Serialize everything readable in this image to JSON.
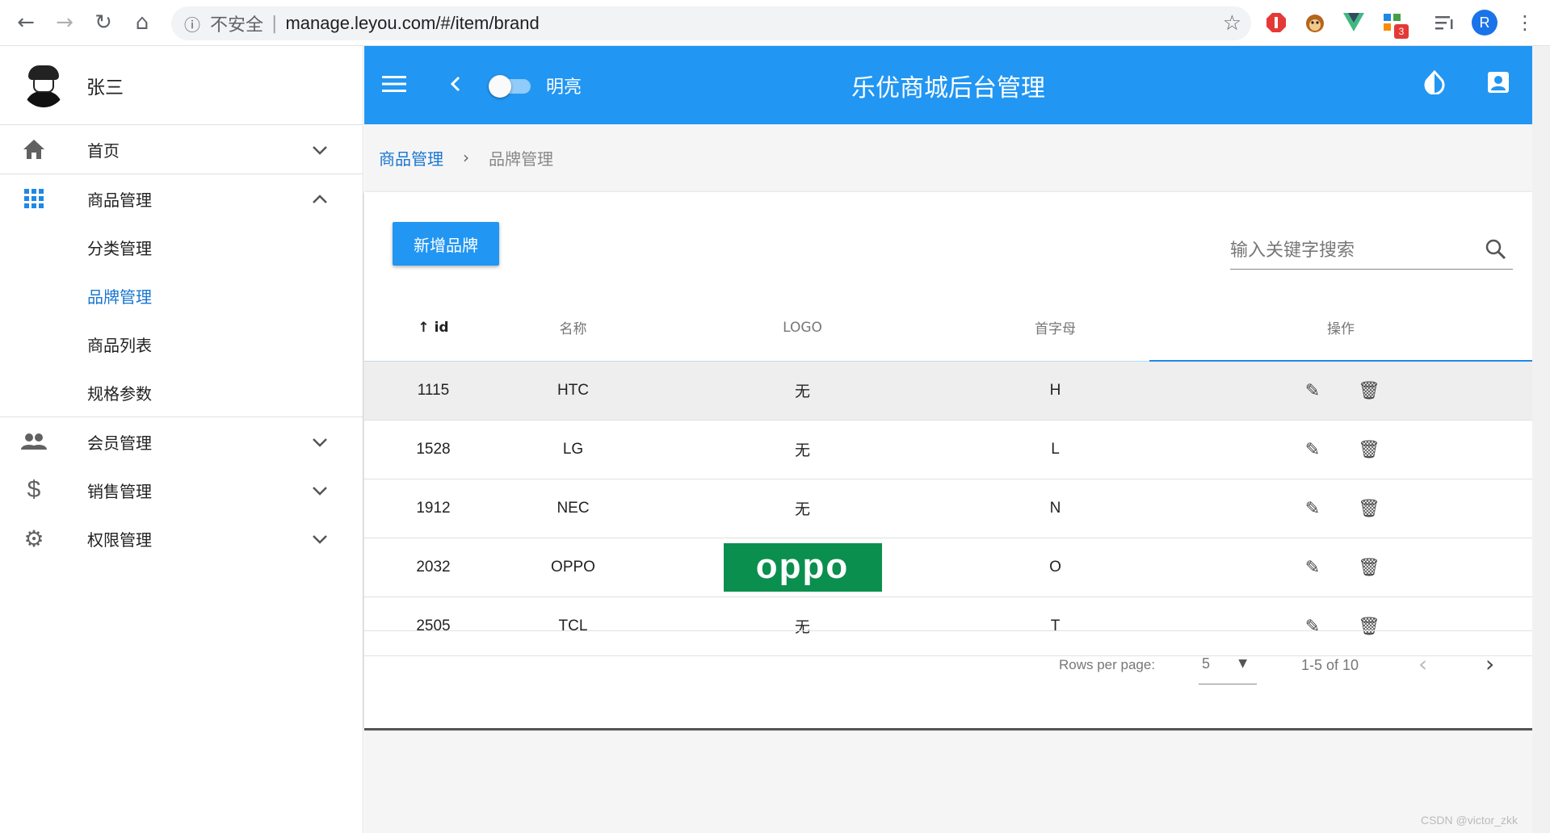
{
  "browser": {
    "insecure_label": "不安全",
    "url": "manage.leyou.com/#/item/brand",
    "ext_badge": "3",
    "profile_initial": "R"
  },
  "sidebar": {
    "user_name": "张三",
    "items": [
      {
        "label": "首页",
        "icon": "home-icon"
      },
      {
        "label": "商品管理",
        "icon": "apps-grid-icon"
      },
      {
        "label": "会员管理",
        "icon": "people-icon"
      },
      {
        "label": "销售管理",
        "icon": "dollar-icon"
      },
      {
        "label": "权限管理",
        "icon": "gear-icon"
      }
    ],
    "sub_items": [
      "分类管理",
      "品牌管理",
      "商品列表",
      "规格参数"
    ],
    "active_sub": "品牌管理"
  },
  "appbar": {
    "toggle_label": "明亮",
    "title": "乐优商城后台管理"
  },
  "breadcrumb": {
    "parent": "商品管理",
    "current": "品牌管理"
  },
  "toolbar": {
    "add_label": "新增品牌",
    "search_placeholder": "输入关键字搜索"
  },
  "table": {
    "headers": [
      "id",
      "名称",
      "LOGO",
      "首字母",
      "操作"
    ],
    "rows": [
      {
        "id": "1115",
        "name": "HTC",
        "logo": "无",
        "letter": "H"
      },
      {
        "id": "1528",
        "name": "LG",
        "logo": "无",
        "letter": "L"
      },
      {
        "id": "1912",
        "name": "NEC",
        "logo": "无",
        "letter": "N"
      },
      {
        "id": "2032",
        "name": "OPPO",
        "logo_image_text": "oppo",
        "letter": "O"
      },
      {
        "id": "2505",
        "name": "TCL",
        "logo": "无",
        "letter": "T"
      }
    ]
  },
  "pagination": {
    "rows_per_page_label": "Rows per page:",
    "rows_per_page": "5",
    "range": "1-5 of 10"
  },
  "watermark": "CSDN @victor_zkk",
  "colors": {
    "primary": "#2196f3",
    "active_link": "#1976d2",
    "oppo_green": "#0a8f4e"
  }
}
